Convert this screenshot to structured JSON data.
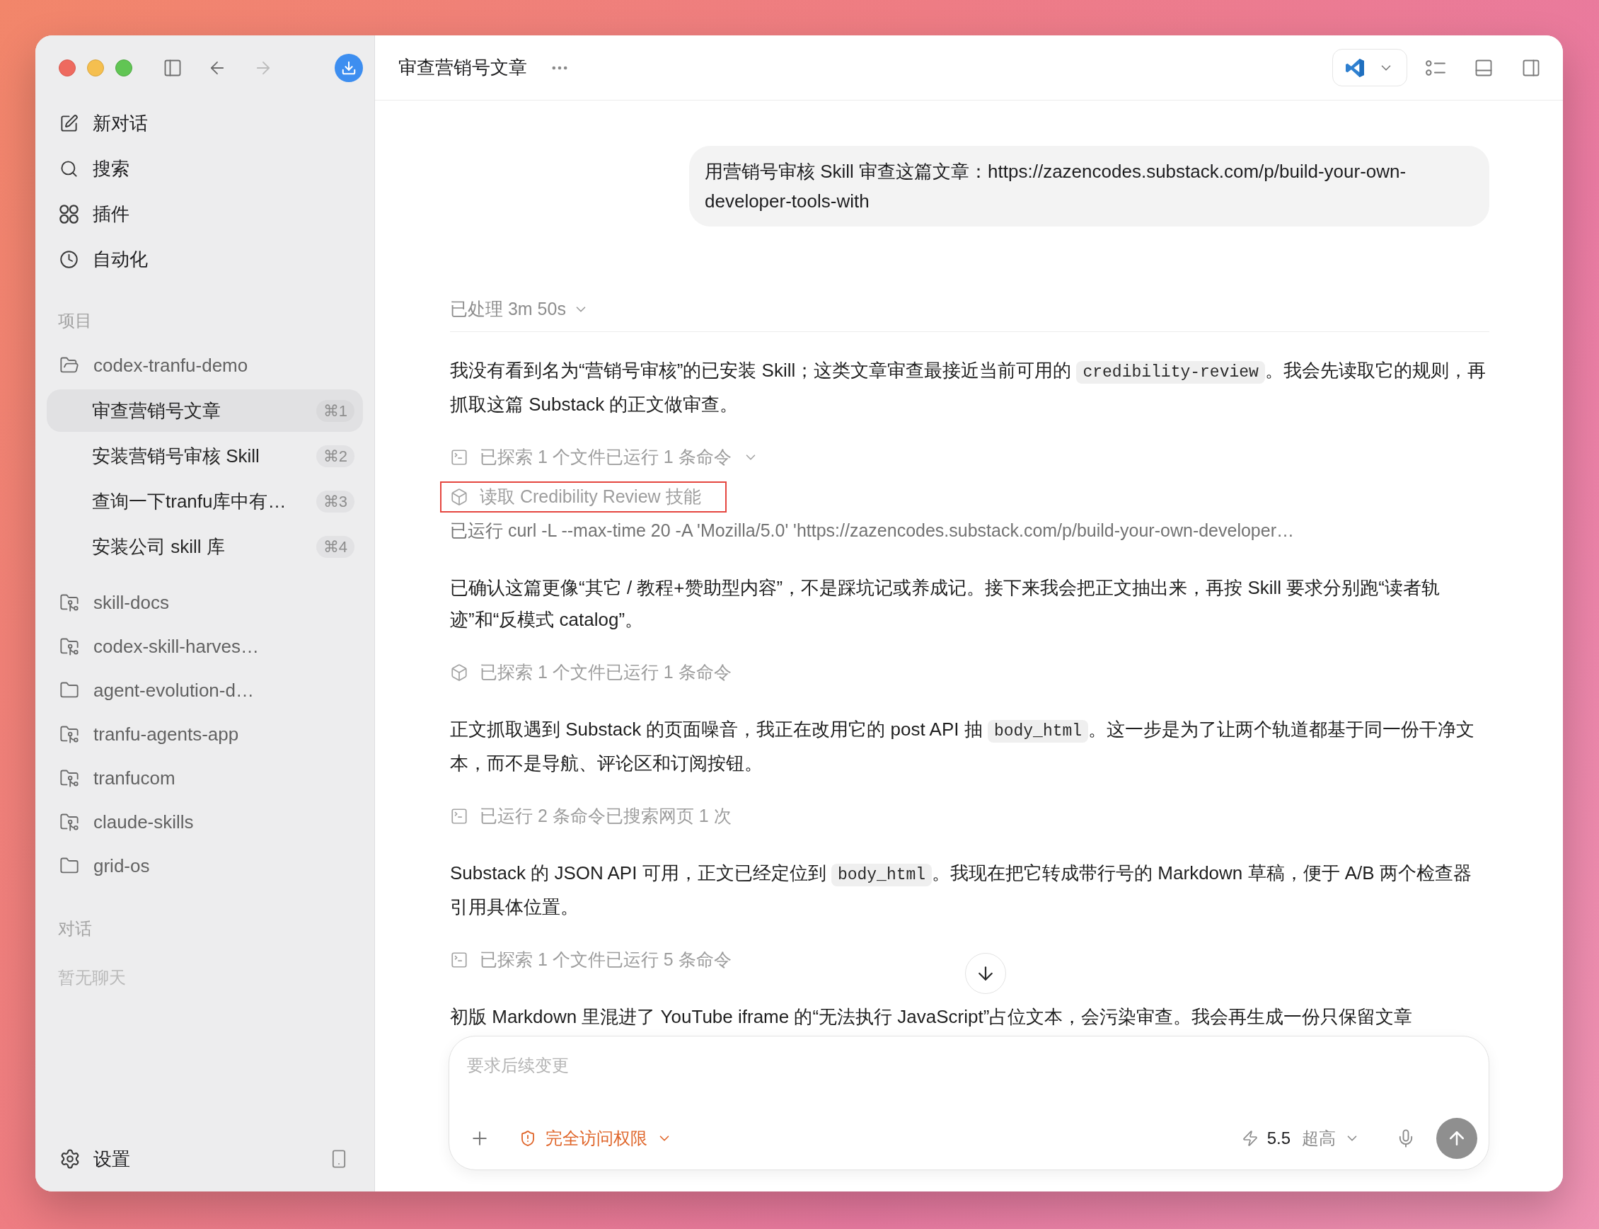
{
  "toolbar": {
    "back": {
      "disabled": false
    },
    "forward": {
      "disabled": true
    }
  },
  "sidebar": {
    "nav": [
      {
        "label": "新对话"
      },
      {
        "label": "搜索"
      },
      {
        "label": "插件"
      },
      {
        "label": "自动化"
      }
    ],
    "projects_heading": "项目",
    "projects": [
      {
        "name": "codex-tranfu-demo",
        "kind": "folder",
        "expanded": true,
        "threads": [
          {
            "title": "审查营销号文章",
            "shortcut": "⌘1",
            "selected": true
          },
          {
            "title": "安装营销号审核 Skill",
            "shortcut": "⌘2",
            "selected": false
          },
          {
            "title": "查询一下tranfu库中有…",
            "shortcut": "⌘3",
            "selected": false
          },
          {
            "title": "安装公司 skill 库",
            "shortcut": "⌘4",
            "selected": false
          }
        ]
      },
      {
        "name": "skill-docs",
        "kind": "repo",
        "expanded": false
      },
      {
        "name": "codex-skill-harves…",
        "kind": "repo",
        "expanded": false
      },
      {
        "name": "agent-evolution-d…",
        "kind": "folder",
        "expanded": false
      },
      {
        "name": "tranfu-agents-app",
        "kind": "repo",
        "expanded": false
      },
      {
        "name": "tranfucom",
        "kind": "repo",
        "expanded": false
      },
      {
        "name": "claude-skills",
        "kind": "repo",
        "expanded": false
      },
      {
        "name": "grid-os",
        "kind": "folder",
        "expanded": false
      }
    ],
    "chats_heading": "对话",
    "chats_empty": "暂无聊天",
    "settings": "设置"
  },
  "header": {
    "title": "审查营销号文章"
  },
  "user_message": "用营销号审核 Skill 审查这篇文章：https://zazencodes.substack.com/p/build-your-own-developer-tools-with",
  "transcript": [
    {
      "kind": "status",
      "text": "已处理 3m 50s",
      "expanded": true
    },
    {
      "kind": "paragraph",
      "parts": [
        {
          "kind": "text",
          "text": "我没有看到名为“营销号审核”的已安装 Skill；这类文章审查最接近当前可用的 "
        },
        {
          "kind": "code",
          "text": "credibility-review"
        },
        {
          "kind": "text",
          "text": "。我会先读取它的规则，再抓取这篇 Substack 的正文做审查。"
        }
      ]
    },
    {
      "kind": "shell",
      "text": "已探索 1 个文件已运行 1 条命令",
      "expanded": true,
      "children": [
        {
          "kind": "skill",
          "text": "读取 Credibility Review 技能",
          "highlighted": true
        },
        {
          "kind": "command",
          "text": "已运行 curl -L --max-time 20 -A 'Mozilla/5.0' 'https://zazencodes.substack.com/p/build-your-own-developer…"
        }
      ]
    },
    {
      "kind": "paragraph",
      "parts": [
        {
          "kind": "text",
          "text": "已确认这篇更像“其它 / 教程+赞助型内容”，不是踩坑记或养成记。接下来我会把正文抽出来，再按 Skill 要求分别跑“读者轨迹”和“反模式 catalog”。"
        }
      ]
    },
    {
      "kind": "skill",
      "text": "已探索 1 个文件已运行 1 条命令"
    },
    {
      "kind": "paragraph",
      "parts": [
        {
          "kind": "text",
          "text": "正文抓取遇到 Substack 的页面噪音，我正在改用它的 post API 抽 "
        },
        {
          "kind": "code",
          "text": "body_html"
        },
        {
          "kind": "text",
          "text": "。这一步是为了让两个轨道都基于同一份干净文本，而不是导航、评论区和订阅按钮。"
        }
      ]
    },
    {
      "kind": "shell",
      "text": "已运行 2 条命令已搜索网页 1 次"
    },
    {
      "kind": "paragraph",
      "parts": [
        {
          "kind": "text",
          "text": "Substack 的 JSON API 可用，正文已经定位到 "
        },
        {
          "kind": "code",
          "text": "body_html"
        },
        {
          "kind": "text",
          "text": "。我现在把它转成带行号的 Markdown 草稿，便于 A/B 两个检查器引用具体位置。"
        }
      ]
    },
    {
      "kind": "shell",
      "text": "已探索 1 个文件已运行 5 条命令"
    },
    {
      "kind": "paragraph",
      "parts": [
        {
          "kind": "text",
          "text": "初版 Markdown 里混进了 YouTube iframe 的“无法执行 JavaScript”占位文本，会污染审查。我会再生成一份只保留文章"
        }
      ]
    }
  ],
  "composer": {
    "placeholder": "要求后续变更",
    "access": "完全访问权限",
    "model": "5.5",
    "effort": "超高"
  }
}
